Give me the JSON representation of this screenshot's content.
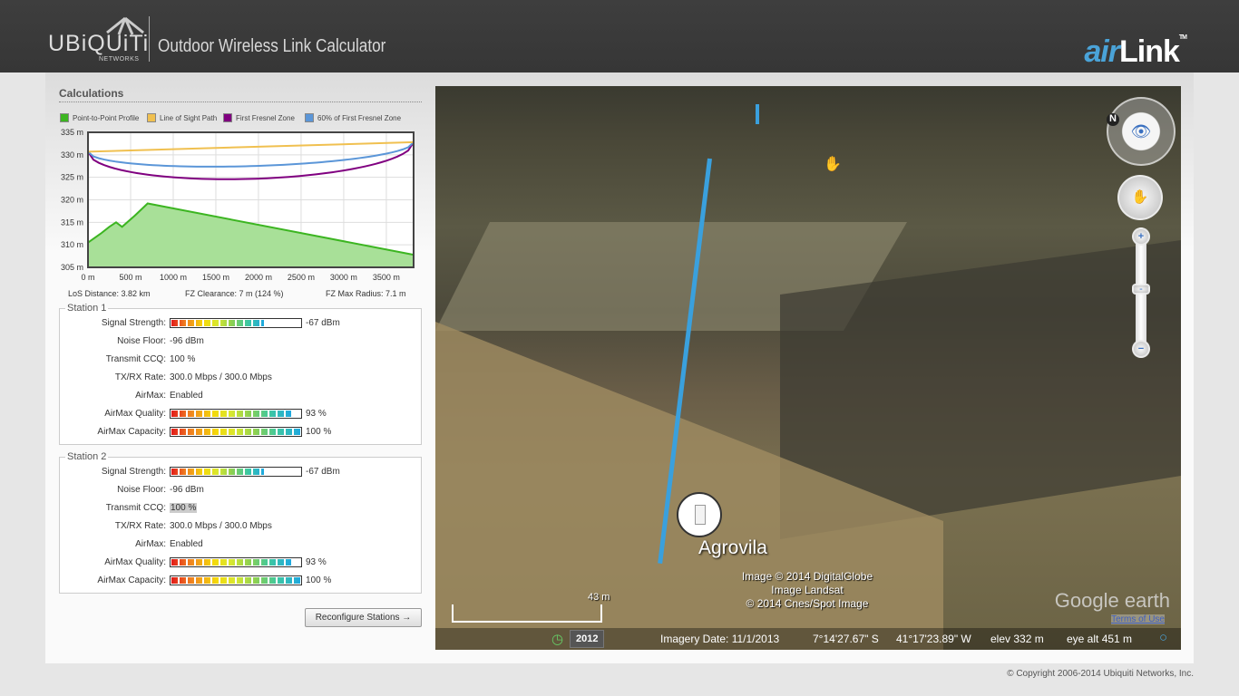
{
  "header": {
    "brand": "UBiQUiTi",
    "brand_sub": "NETWORKS",
    "title": "Outdoor Wireless Link Calculator",
    "product_a": "air",
    "product_b": "Link",
    "tm": "TM"
  },
  "calc": {
    "title": "Calculations",
    "legend": [
      {
        "label": "Point-to-Point Profile",
        "color": "#3cb521"
      },
      {
        "label": "Line of Sight Path",
        "color": "#f0c050"
      },
      {
        "label": "First Fresnel Zone",
        "color": "#800080"
      },
      {
        "label": "60% of First Fresnel Zone",
        "color": "#5b96d8"
      }
    ],
    "los_distance": "LoS Distance: 3.82 km",
    "fz_clearance": "FZ Clearance: 7 m  (124 %)",
    "fz_max_radius": "FZ Max Radius: 7.1 m"
  },
  "chart_data": {
    "type": "area",
    "xlim": [
      0,
      3820
    ],
    "ylim": [
      305,
      335
    ],
    "xticks": [
      0,
      500,
      1000,
      1500,
      2000,
      2500,
      3000,
      3500
    ],
    "xtick_labels": [
      "0 m",
      "500 m",
      "1000 m",
      "1500 m",
      "2000 m",
      "2500 m",
      "3000 m",
      "3500 m"
    ],
    "yticks": [
      305,
      310,
      315,
      320,
      325,
      330,
      335
    ],
    "ytick_labels": [
      "305 m",
      "310 m",
      "315 m",
      "320 m",
      "325 m",
      "330 m",
      "335 m"
    ],
    "profile": [
      [
        0,
        310.5
      ],
      [
        150,
        312.5
      ],
      [
        250,
        314
      ],
      [
        330,
        315
      ],
      [
        400,
        314
      ],
      [
        550,
        316.5
      ],
      [
        700,
        319.2
      ],
      [
        3820,
        307.8
      ]
    ],
    "los": [
      [
        0,
        330.7
      ],
      [
        3820,
        332.8
      ]
    ],
    "fresnel_max_radius": 7.1,
    "fresnel_60_fraction": 0.6
  },
  "stations": [
    {
      "title": "Station 1",
      "rows": [
        {
          "label": "Signal Strength:",
          "value": "-67 dBm",
          "bar": 0.72
        },
        {
          "label": "Noise Floor:",
          "value": "-96 dBm"
        },
        {
          "label": "Transmit CCQ:",
          "value": "100 %"
        },
        {
          "label": "TX/RX Rate:",
          "value": "300.0 Mbps / 300.0 Mbps"
        },
        {
          "label": "AirMax:",
          "value": "Enabled"
        },
        {
          "label": "AirMax Quality:",
          "value": "93 %",
          "bar": 0.93
        },
        {
          "label": "AirMax Capacity:",
          "value": "100 %",
          "bar": 1.0
        }
      ]
    },
    {
      "title": "Station 2",
      "rows": [
        {
          "label": "Signal Strength:",
          "value": "-67 dBm",
          "bar": 0.72
        },
        {
          "label": "Noise Floor:",
          "value": "-96 dBm"
        },
        {
          "label": "Transmit CCQ:",
          "value": "100 %"
        },
        {
          "label": "TX/RX Rate:",
          "value": "300.0 Mbps / 300.0 Mbps"
        },
        {
          "label": "AirMax:",
          "value": "Enabled"
        },
        {
          "label": "AirMax Quality:",
          "value": "93 %",
          "bar": 0.93
        },
        {
          "label": "AirMax Capacity:",
          "value": "100 %",
          "bar": 1.0
        }
      ]
    }
  ],
  "reconfigure": "Reconfigure Stations →",
  "map": {
    "place": "Agrovila",
    "credits": [
      "Image © 2014 DigitalGlobe",
      "Image Landsat",
      "© 2014 Cnes/Spot Image"
    ],
    "google": "Google earth",
    "terms": "Terms of Use",
    "scale": "43 m",
    "year": "2012",
    "imagery_date": "Imagery Date: 11/1/2013",
    "lat": "7°14'27.67\" S",
    "lon": "41°17'23.89\" W",
    "elev": "elev   332 m",
    "eye_alt": "eye alt    451 m"
  },
  "footer": "© Copyright 2006-2014 Ubiquiti Networks, Inc."
}
